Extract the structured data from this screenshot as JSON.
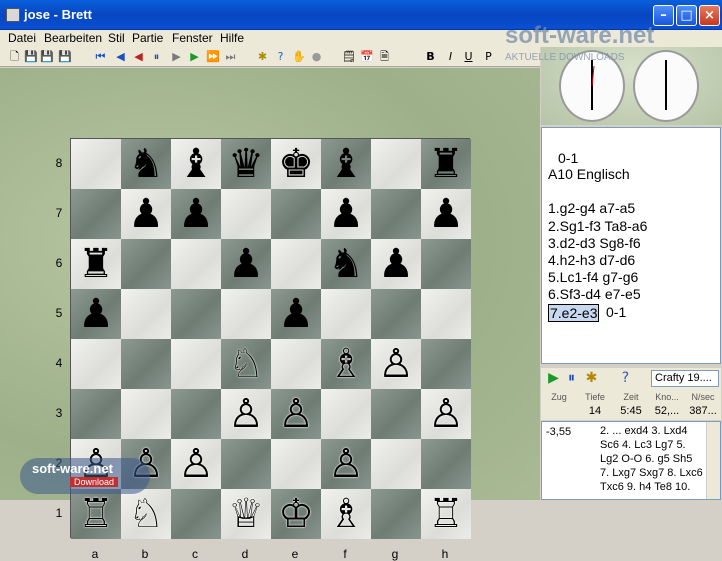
{
  "window": {
    "title": "jose - Brett"
  },
  "menu": [
    "Datei",
    "Bearbeiten",
    "Stil",
    "Partie",
    "Fenster",
    "Hilfe"
  ],
  "board": {
    "ranks": [
      "8",
      "7",
      "6",
      "5",
      "4",
      "3",
      "2",
      "1"
    ],
    "files": [
      "a",
      "b",
      "c",
      "d",
      "e",
      "f",
      "g",
      "h"
    ],
    "squares": [
      [
        "",
        "♞",
        "♝",
        "♛",
        "♚",
        "♝",
        "",
        "♜"
      ],
      [
        "",
        "♟",
        "♟",
        "",
        "",
        "♟",
        "",
        "♟"
      ],
      [
        "♜",
        "",
        "",
        "♟",
        "",
        "♞",
        "♟",
        ""
      ],
      [
        "♟",
        "",
        "",
        "",
        "♟",
        "",
        "",
        ""
      ],
      [
        "",
        "",
        "",
        "♘",
        "",
        "♗",
        "♙",
        ""
      ],
      [
        "",
        "",
        "",
        "♙",
        "♙",
        "",
        "",
        "♙"
      ],
      [
        "♙",
        "♙",
        "♙",
        "",
        "",
        "♙",
        "",
        ""
      ],
      [
        "♖",
        "♘",
        "",
        "♕",
        "♔",
        "♗",
        "",
        "♖"
      ]
    ]
  },
  "notation": {
    "result": "0-1",
    "opening": "A10 Englisch",
    "moves": [
      "1.g2-g4 a7-a5",
      "2.Sg1-f3 Ta8-a6",
      "3.d2-d3 Sg8-f6",
      "4.h2-h3 d7-d6",
      "5.Lc1-f4 g7-g6",
      "6.Sf3-d4 e7-e5"
    ],
    "last_move": "7.e2-e3",
    "last_result": "0-1"
  },
  "engine": {
    "name": "Crafty 19....",
    "headers": [
      "Zug",
      "Tiefe",
      "Zeit",
      "Kno...",
      "N/sec"
    ],
    "values": [
      "",
      "14",
      "5:45",
      "52,...",
      "387..."
    ],
    "score": "-3,55",
    "pv_lines": [
      "2. ... exd4 3. Lxd4",
      "Sc6 4. Lc3 Lg7 5.",
      "Lg2 O-O 6. g5 Sh5",
      "7. Lxg7 Sxg7 8. Lxc6",
      "Txc6 9. h4 Te8 10."
    ]
  },
  "watermarks": {
    "top": "soft-ware.net",
    "top_sub": "AKTUELLE DOWNLOADS",
    "bottom": "soft-ware.net",
    "bottom_sub": "Download"
  }
}
